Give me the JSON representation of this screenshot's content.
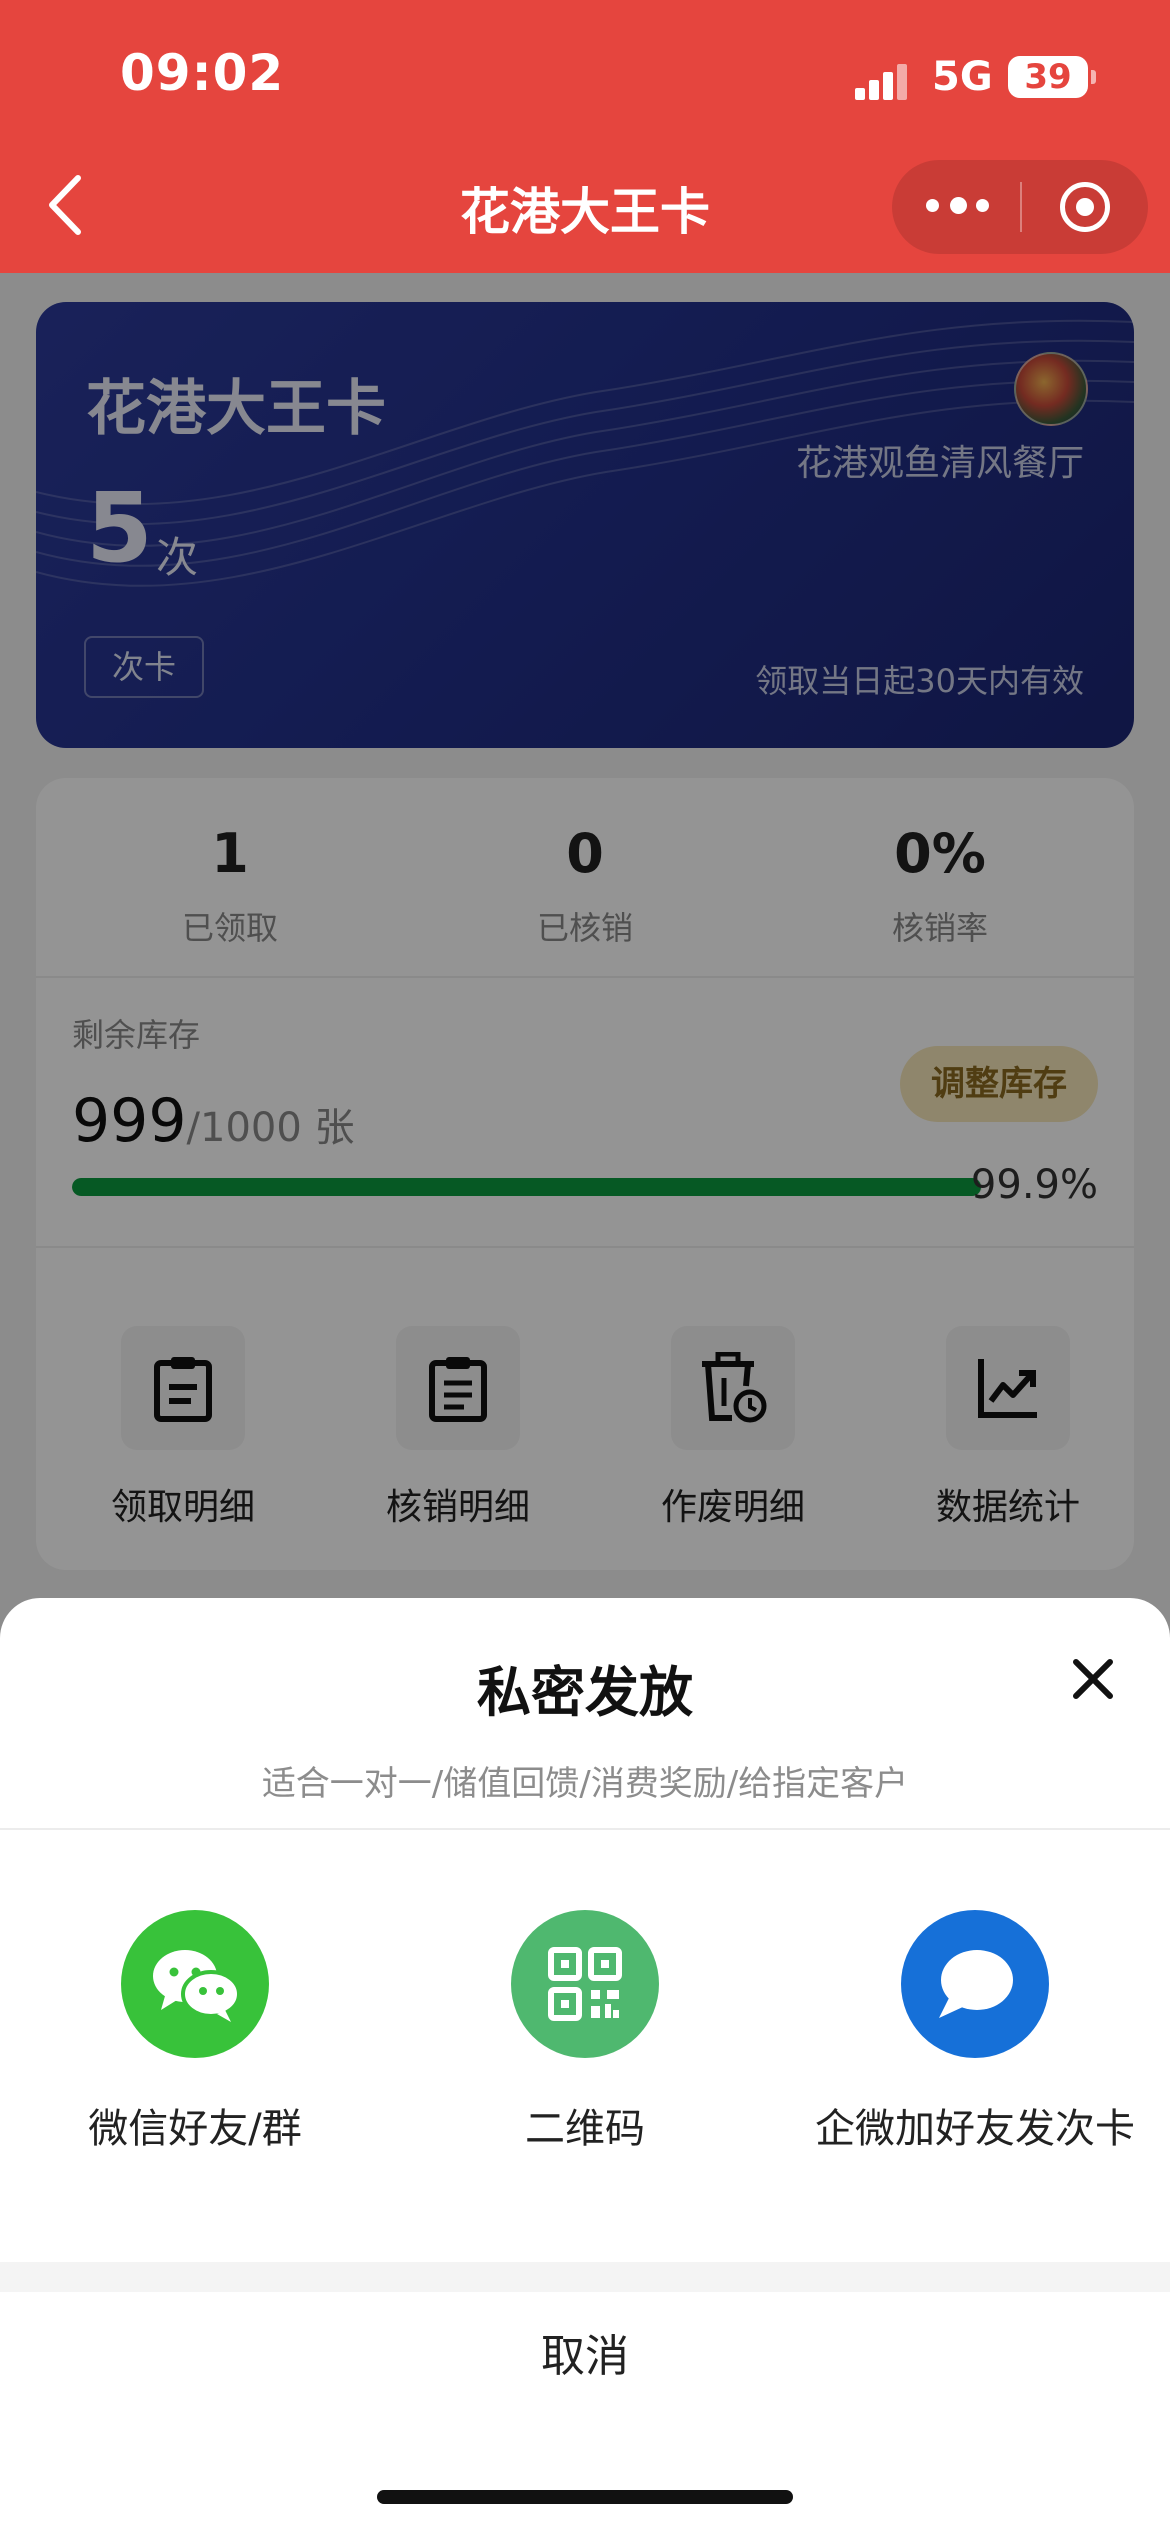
{
  "status_bar": {
    "time": "09:02",
    "network": "5G",
    "battery": "39"
  },
  "nav": {
    "title": "花港大王卡",
    "more_icon": "more-dots-icon",
    "close_icon": "target-icon"
  },
  "card": {
    "title": "花港大王卡",
    "count": "5",
    "unit": "次",
    "tag": "次卡",
    "store_name": "花港观鱼清风餐厅",
    "validity": "领取当日起30天内有效",
    "colors": {
      "gradient_start": "#2c3a9a",
      "gradient_end": "#1c2674"
    }
  },
  "stats": [
    {
      "value": "1",
      "label": "已领取"
    },
    {
      "value": "0",
      "label": "已核销"
    },
    {
      "value": "0%",
      "label": "核销率"
    }
  ],
  "inventory": {
    "label": "剩余库存",
    "remaining": "999",
    "total": "/1000 张",
    "adjust_label": "调整库存",
    "percent_text": "99.9%",
    "fill_fraction": 0.999,
    "bar_color": "#0c9a3e"
  },
  "actions": [
    {
      "label": "领取明细",
      "icon": "clipboard-icon"
    },
    {
      "label": "核销明细",
      "icon": "clipboard-list-icon"
    },
    {
      "label": "作废明细",
      "icon": "trash-clock-icon"
    },
    {
      "label": "数据统计",
      "icon": "chart-line-icon"
    }
  ],
  "sheet": {
    "title": "私密发放",
    "subtitle": "适合一对一/储值回馈/消费奖励/给指定客户",
    "options": [
      {
        "label": "微信好友/群",
        "icon": "wechat-icon",
        "color": "#38c23a"
      },
      {
        "label": "二维码",
        "icon": "qr-code-icon",
        "color": "#4fb86f"
      },
      {
        "label": "企微加好友发次卡",
        "icon": "chat-bubble-icon",
        "color": "#1670d8"
      }
    ],
    "cancel_label": "取消"
  },
  "colors": {
    "primary_red": "#e5453e"
  }
}
